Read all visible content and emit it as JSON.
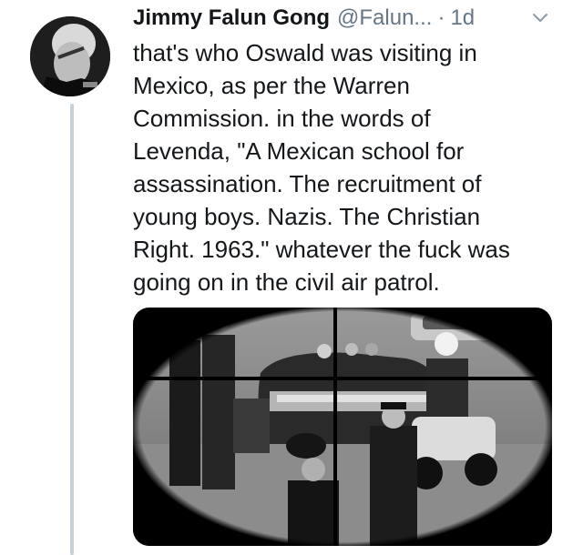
{
  "tweet": {
    "author_name": "Jimmy Falun Gong",
    "handle": "@Falun...",
    "separator": "·",
    "time": "1d",
    "text_lines": [
      "that's who Oswald was visiting in",
      "Mexico, as per the Warren",
      "Commission. in the words of",
      "Levenda, \"A Mexican school for",
      "assassination. The recruitment of",
      "young boys. Nazis. The Christian",
      "Right. 1963.\" whatever the fuck was",
      "going on in the civil air patrol."
    ]
  },
  "icons": {
    "menu": "chevron-down-icon"
  },
  "colors": {
    "text": "#14171a",
    "secondary": "#657786",
    "thread_line": "#c7d0d6"
  }
}
